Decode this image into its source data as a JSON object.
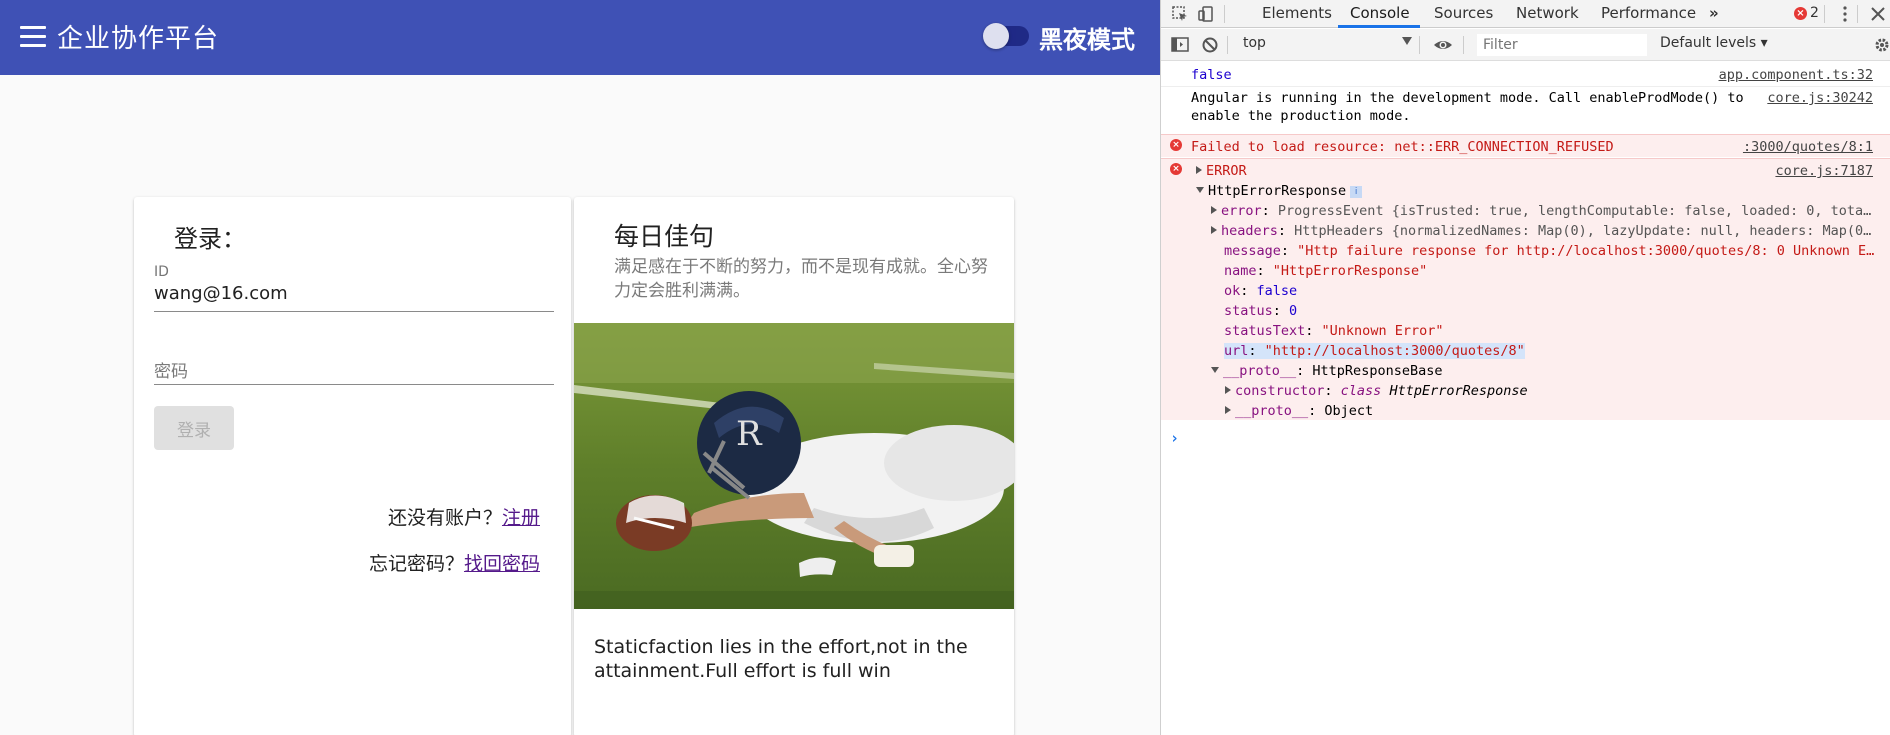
{
  "app": {
    "title": "企业协作平台",
    "dark_mode_label": "黑夜模式",
    "login": {
      "title": "登录：",
      "id_label": "ID",
      "id_value": "wang@16.com",
      "password_placeholder": "密码",
      "login_button": "登录",
      "no_account_text": "还没有账户？",
      "register_link": "注册",
      "forgot_text": "忘记密码？",
      "recover_link": "找回密码"
    },
    "quote": {
      "title": "每日佳句",
      "chinese": "满足感在于不断的努力，而不是现有成就。全心努力定会胜利满满。",
      "english": "Staticfaction lies in the effort,not in the attainment.Full effort is full win"
    },
    "colors": {
      "primary": "#3f51b5"
    }
  },
  "devtools": {
    "tabs": [
      "Elements",
      "Console",
      "Sources",
      "Network",
      "Performance"
    ],
    "active_tab": "Console",
    "more_tabs_icon": "»",
    "error_count": "2",
    "context": "top",
    "filter_placeholder": "Filter",
    "levels": "Default levels ▾",
    "console": {
      "line1": {
        "text": "false",
        "source": "app.component.ts:32"
      },
      "line2": {
        "text": "Angular is running in the development mode. Call enableProdMode() to",
        "text2": "enable the production mode.",
        "source": "core.js:30242"
      },
      "line3": {
        "text": "Failed to load resource: net::ERR_CONNECTION_REFUSED",
        "source": ":3000/quotes/8:1"
      },
      "line4": {
        "text": "ERROR",
        "source": "core.js:7187"
      },
      "obj_name": "HttpErrorResponse",
      "props": {
        "error_key": "error",
        "error_val": "ProgressEvent {isTrusted: true, lengthComputable: false, loaded: 0, tota…",
        "headers_key": "headers",
        "headers_val": "HttpHeaders {normalizedNames: Map(0), lazyUpdate: null, headers: Map(0…",
        "message_key": "message",
        "message_val": "\"Http failure response for http://localhost:3000/quotes/8: 0 Unknown E…",
        "name_key": "name",
        "name_val": "\"HttpErrorResponse\"",
        "ok_key": "ok",
        "ok_val": "false",
        "status_key": "status",
        "status_val": "0",
        "statustext_key": "statusText",
        "statustext_val": "\"Unknown Error\"",
        "url_key": "url",
        "url_val": "\"http://localhost:3000/quotes/8\"",
        "proto_key": "__proto__",
        "proto_val": "HttpResponseBase",
        "ctor_key": "constructor",
        "ctor_kw": "class",
        "ctor_val": "HttpErrorResponse",
        "proto2_key": "__proto__",
        "proto2_val": "Object"
      }
    }
  }
}
